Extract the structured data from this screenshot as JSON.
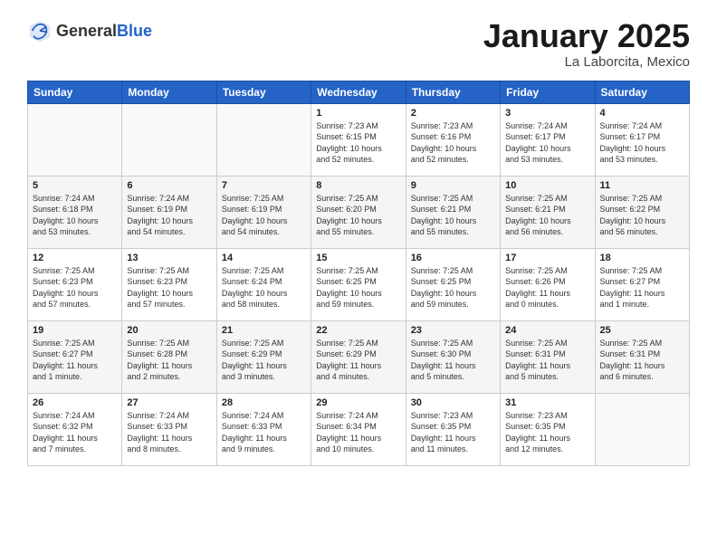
{
  "header": {
    "logo_general": "General",
    "logo_blue": "Blue",
    "title": "January 2025",
    "subtitle": "La Laborcita, Mexico"
  },
  "days_of_week": [
    "Sunday",
    "Monday",
    "Tuesday",
    "Wednesday",
    "Thursday",
    "Friday",
    "Saturday"
  ],
  "weeks": [
    [
      {
        "day": "",
        "info": ""
      },
      {
        "day": "",
        "info": ""
      },
      {
        "day": "",
        "info": ""
      },
      {
        "day": "1",
        "info": "Sunrise: 7:23 AM\nSunset: 6:15 PM\nDaylight: 10 hours\nand 52 minutes."
      },
      {
        "day": "2",
        "info": "Sunrise: 7:23 AM\nSunset: 6:16 PM\nDaylight: 10 hours\nand 52 minutes."
      },
      {
        "day": "3",
        "info": "Sunrise: 7:24 AM\nSunset: 6:17 PM\nDaylight: 10 hours\nand 53 minutes."
      },
      {
        "day": "4",
        "info": "Sunrise: 7:24 AM\nSunset: 6:17 PM\nDaylight: 10 hours\nand 53 minutes."
      }
    ],
    [
      {
        "day": "5",
        "info": "Sunrise: 7:24 AM\nSunset: 6:18 PM\nDaylight: 10 hours\nand 53 minutes."
      },
      {
        "day": "6",
        "info": "Sunrise: 7:24 AM\nSunset: 6:19 PM\nDaylight: 10 hours\nand 54 minutes."
      },
      {
        "day": "7",
        "info": "Sunrise: 7:25 AM\nSunset: 6:19 PM\nDaylight: 10 hours\nand 54 minutes."
      },
      {
        "day": "8",
        "info": "Sunrise: 7:25 AM\nSunset: 6:20 PM\nDaylight: 10 hours\nand 55 minutes."
      },
      {
        "day": "9",
        "info": "Sunrise: 7:25 AM\nSunset: 6:21 PM\nDaylight: 10 hours\nand 55 minutes."
      },
      {
        "day": "10",
        "info": "Sunrise: 7:25 AM\nSunset: 6:21 PM\nDaylight: 10 hours\nand 56 minutes."
      },
      {
        "day": "11",
        "info": "Sunrise: 7:25 AM\nSunset: 6:22 PM\nDaylight: 10 hours\nand 56 minutes."
      }
    ],
    [
      {
        "day": "12",
        "info": "Sunrise: 7:25 AM\nSunset: 6:23 PM\nDaylight: 10 hours\nand 57 minutes."
      },
      {
        "day": "13",
        "info": "Sunrise: 7:25 AM\nSunset: 6:23 PM\nDaylight: 10 hours\nand 57 minutes."
      },
      {
        "day": "14",
        "info": "Sunrise: 7:25 AM\nSunset: 6:24 PM\nDaylight: 10 hours\nand 58 minutes."
      },
      {
        "day": "15",
        "info": "Sunrise: 7:25 AM\nSunset: 6:25 PM\nDaylight: 10 hours\nand 59 minutes."
      },
      {
        "day": "16",
        "info": "Sunrise: 7:25 AM\nSunset: 6:25 PM\nDaylight: 10 hours\nand 59 minutes."
      },
      {
        "day": "17",
        "info": "Sunrise: 7:25 AM\nSunset: 6:26 PM\nDaylight: 11 hours\nand 0 minutes."
      },
      {
        "day": "18",
        "info": "Sunrise: 7:25 AM\nSunset: 6:27 PM\nDaylight: 11 hours\nand 1 minute."
      }
    ],
    [
      {
        "day": "19",
        "info": "Sunrise: 7:25 AM\nSunset: 6:27 PM\nDaylight: 11 hours\nand 1 minute."
      },
      {
        "day": "20",
        "info": "Sunrise: 7:25 AM\nSunset: 6:28 PM\nDaylight: 11 hours\nand 2 minutes."
      },
      {
        "day": "21",
        "info": "Sunrise: 7:25 AM\nSunset: 6:29 PM\nDaylight: 11 hours\nand 3 minutes."
      },
      {
        "day": "22",
        "info": "Sunrise: 7:25 AM\nSunset: 6:29 PM\nDaylight: 11 hours\nand 4 minutes."
      },
      {
        "day": "23",
        "info": "Sunrise: 7:25 AM\nSunset: 6:30 PM\nDaylight: 11 hours\nand 5 minutes."
      },
      {
        "day": "24",
        "info": "Sunrise: 7:25 AM\nSunset: 6:31 PM\nDaylight: 11 hours\nand 5 minutes."
      },
      {
        "day": "25",
        "info": "Sunrise: 7:25 AM\nSunset: 6:31 PM\nDaylight: 11 hours\nand 6 minutes."
      }
    ],
    [
      {
        "day": "26",
        "info": "Sunrise: 7:24 AM\nSunset: 6:32 PM\nDaylight: 11 hours\nand 7 minutes."
      },
      {
        "day": "27",
        "info": "Sunrise: 7:24 AM\nSunset: 6:33 PM\nDaylight: 11 hours\nand 8 minutes."
      },
      {
        "day": "28",
        "info": "Sunrise: 7:24 AM\nSunset: 6:33 PM\nDaylight: 11 hours\nand 9 minutes."
      },
      {
        "day": "29",
        "info": "Sunrise: 7:24 AM\nSunset: 6:34 PM\nDaylight: 11 hours\nand 10 minutes."
      },
      {
        "day": "30",
        "info": "Sunrise: 7:23 AM\nSunset: 6:35 PM\nDaylight: 11 hours\nand 11 minutes."
      },
      {
        "day": "31",
        "info": "Sunrise: 7:23 AM\nSunset: 6:35 PM\nDaylight: 11 hours\nand 12 minutes."
      },
      {
        "day": "",
        "info": ""
      }
    ]
  ]
}
